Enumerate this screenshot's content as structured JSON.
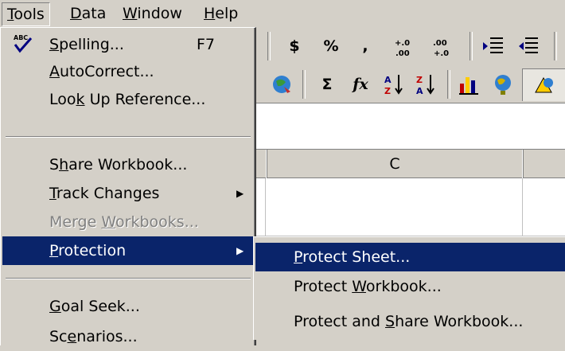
{
  "menubar": [
    {
      "label": "Tools",
      "mnemonic": "T",
      "rest": "ools",
      "open": true
    },
    {
      "label": "Data",
      "mnemonic": "D",
      "rest": "ata",
      "open": false
    },
    {
      "label": "Window",
      "mnemonic": "W",
      "rest": "indow",
      "open": false
    },
    {
      "label": "Help",
      "mnemonic": "H",
      "rest": "elp",
      "open": false
    }
  ],
  "toolbar1": {
    "currency": "$",
    "percent": "%",
    "comma": ",",
    "increase_decimal": ".0→.00",
    "decrease_decimal": ".00→.0",
    "decrease_indent_icon": "decrease-indent-icon",
    "increase_indent_icon": "increase-indent-icon"
  },
  "toolbar2": {
    "autosum": "Σ",
    "function": "fx",
    "sort_asc_icon": "sort-ascending-icon",
    "sort_desc_icon": "sort-descending-icon",
    "chart_icon": "chart-wizard-icon",
    "map_icon": "map-icon",
    "drawing_icon": "drawing-icon",
    "web_icon": "web-toolbar-icon"
  },
  "sheet": {
    "column_c": "C"
  },
  "tools_menu": {
    "items": [
      {
        "pre": "",
        "u": "S",
        "post": "pelling...",
        "shortcut": "F7"
      },
      {
        "pre": "",
        "u": "A",
        "post": "utoCorrect..."
      },
      {
        "pre": "Loo",
        "u": "k",
        "post": " Up Reference..."
      },
      {
        "pre": "S",
        "u": "h",
        "post": "are Workbook..."
      },
      {
        "pre": "",
        "u": "T",
        "post": "rack Changes"
      },
      {
        "pre": "Merge ",
        "u": "W",
        "post": "orkbooks..."
      },
      {
        "pre": "",
        "u": "P",
        "post": "rotection"
      },
      {
        "pre": "",
        "u": "G",
        "post": "oal Seek..."
      },
      {
        "pre": "Sc",
        "u": "e",
        "post": "narios..."
      }
    ]
  },
  "protection_menu": {
    "items": [
      {
        "pre": "",
        "u": "P",
        "post": "rotect Sheet..."
      },
      {
        "pre": "Protect ",
        "u": "W",
        "post": "orkbook..."
      },
      {
        "pre": "Protect and ",
        "u": "S",
        "post": "hare Workbook..."
      }
    ]
  },
  "colors": {
    "face": "#d4d0c8",
    "highlight": "#0a246a",
    "highlight_text": "#ffffff",
    "disabled": "#808080"
  }
}
